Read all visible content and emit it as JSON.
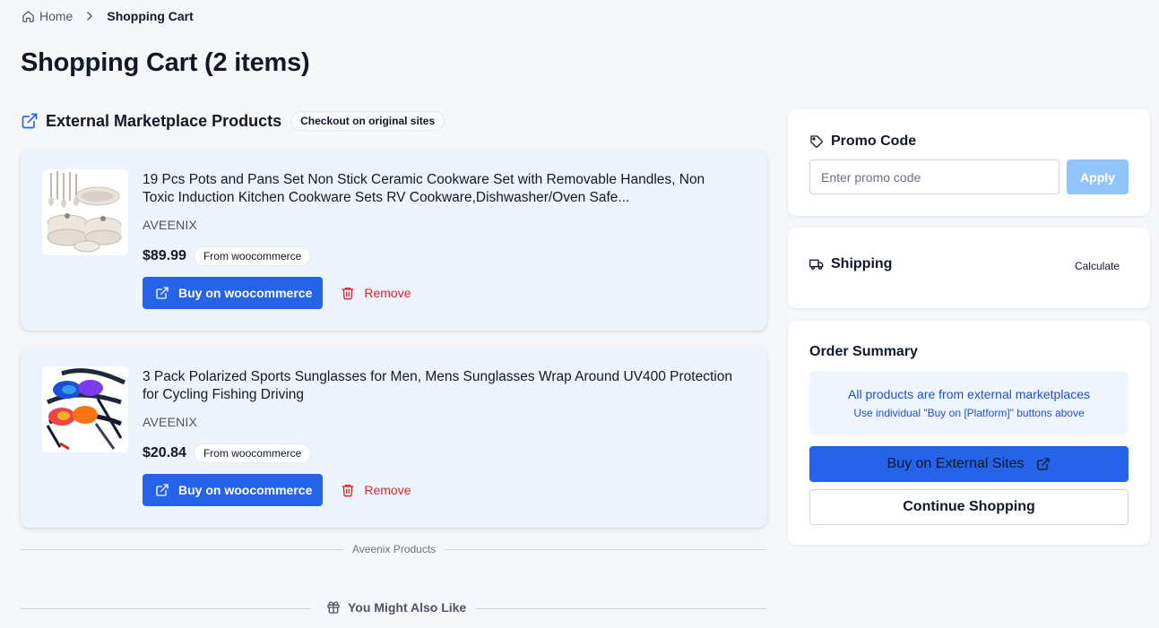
{
  "breadcrumb": {
    "home": "Home",
    "current": "Shopping Cart"
  },
  "page_title": "Shopping Cart (2 items)",
  "external_section": {
    "title": "External Marketplace Products",
    "badge": "Checkout on original sites"
  },
  "items": [
    {
      "name": "19 Pcs Pots and Pans Set Non Stick Ceramic Cookware Set with Removable Handles, Non Toxic Induction Kitchen Cookware Sets RV Cookware,Dishwasher/Oven Safe...",
      "brand": "AVEENIX",
      "price": "$89.99",
      "source": "From woocommerce",
      "buy_label": "Buy on woocommerce",
      "remove_label": "Remove"
    },
    {
      "name": "3 Pack Polarized Sports Sunglasses for Men, Mens Sunglasses Wrap Around UV400 Protection for Cycling Fishing Driving",
      "brand": "AVEENIX",
      "price": "$20.84",
      "source": "From woocommerce",
      "buy_label": "Buy on woocommerce",
      "remove_label": "Remove"
    }
  ],
  "aveenix_divider": "Aveenix Products",
  "also_like": "You Might Also Like",
  "promo": {
    "title": "Promo Code",
    "placeholder": "Enter promo code",
    "apply_label": "Apply"
  },
  "shipping": {
    "title": "Shipping",
    "calculate_label": "Calculate"
  },
  "summary": {
    "title": "Order Summary",
    "notice_title": "All products are from external marketplaces",
    "notice_sub": "Use individual \"Buy on [Platform]\" buttons above",
    "external_button": "Buy on External Sites",
    "continue_button": "Continue Shopping"
  },
  "colors": {
    "accent": "#2563eb",
    "accent_light": "#93c5fd",
    "danger": "#dc2626",
    "card_bg": "#eef4fd",
    "page_bg": "#f5f7fb"
  },
  "icons": {
    "home": "home-icon",
    "chevron": "chevron-right-icon",
    "external": "external-link-icon",
    "trash": "trash-icon",
    "tag": "tag-icon",
    "truck": "truck-icon",
    "gift": "gift-icon"
  }
}
